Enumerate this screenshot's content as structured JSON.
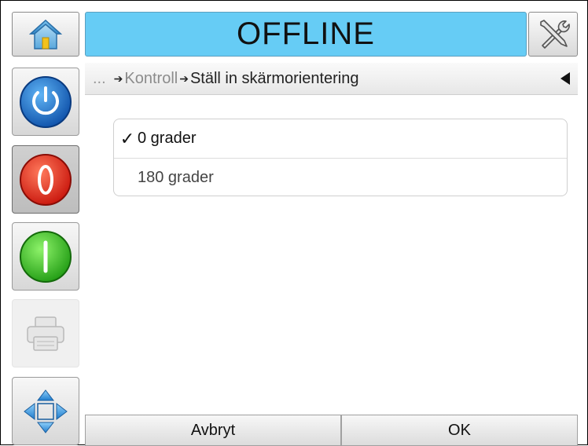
{
  "header": {
    "status": "OFFLINE",
    "status_color": "#66ccf5"
  },
  "left_icons": [
    "home-icon",
    "power-icon",
    "stop-icon",
    "start-icon",
    "printer-icon",
    "navigate-icon"
  ],
  "breadcrumb": {
    "ellipsis": "...",
    "parent": "Kontroll",
    "current": "Ställ in skärmorientering"
  },
  "options": [
    {
      "label": "0 grader",
      "selected": true,
      "check": "✓"
    },
    {
      "label": "180 grader",
      "selected": false,
      "check": ""
    }
  ],
  "footer": {
    "cancel_label": "Avbryt",
    "ok_label": "OK"
  }
}
